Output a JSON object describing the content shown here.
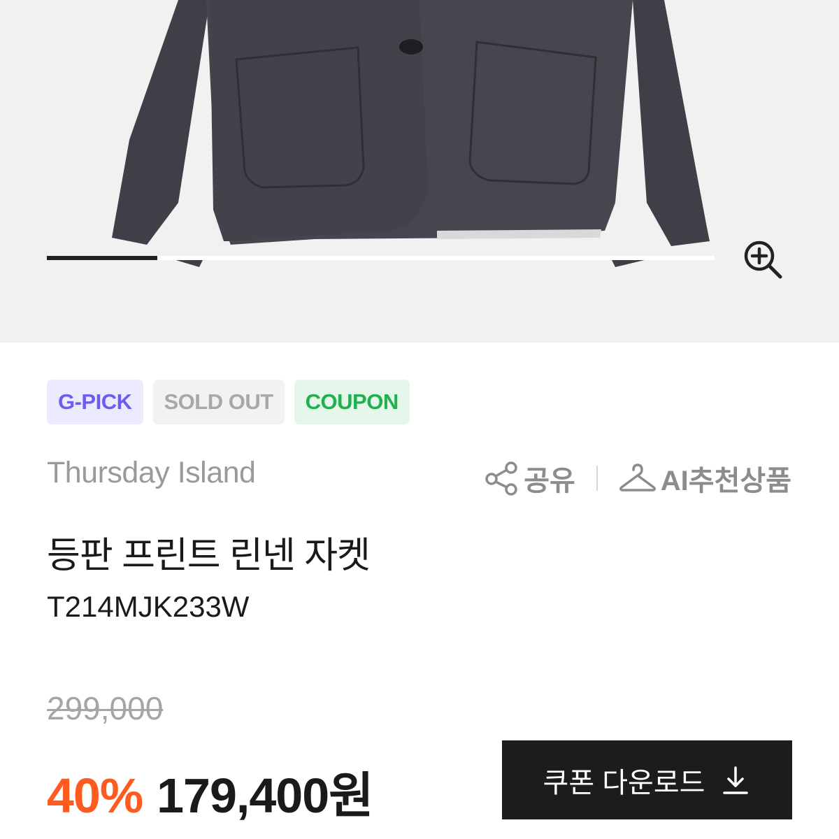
{
  "gallery": {
    "image_alt": "product-photo-jacket",
    "slide_progress": 0.165,
    "zoom_icon": "zoom-in-icon"
  },
  "badges": [
    {
      "label": "G-PICK",
      "color": "#6e5bf0"
    },
    {
      "label": "SOLD OUT",
      "color": "#a8a8a8"
    },
    {
      "label": "COUPON",
      "color": "#22b04e"
    }
  ],
  "brand": "Thursday Island",
  "actions": {
    "share_label": "공유",
    "share_icon": "share-icon",
    "ai_label": "AI추천상품",
    "ai_icon": "hanger-icon"
  },
  "product": {
    "title": "등판 프린트 린넨 자켓",
    "code": "T214MJK233W"
  },
  "price": {
    "original": "299,000",
    "discount": "40%",
    "sale": "179,400원"
  },
  "coupon_button": {
    "label": "쿠폰 다운로드",
    "icon": "download-icon"
  },
  "colors": {
    "discount": "#ff5a1f",
    "button_bg": "#1c1c1c"
  }
}
